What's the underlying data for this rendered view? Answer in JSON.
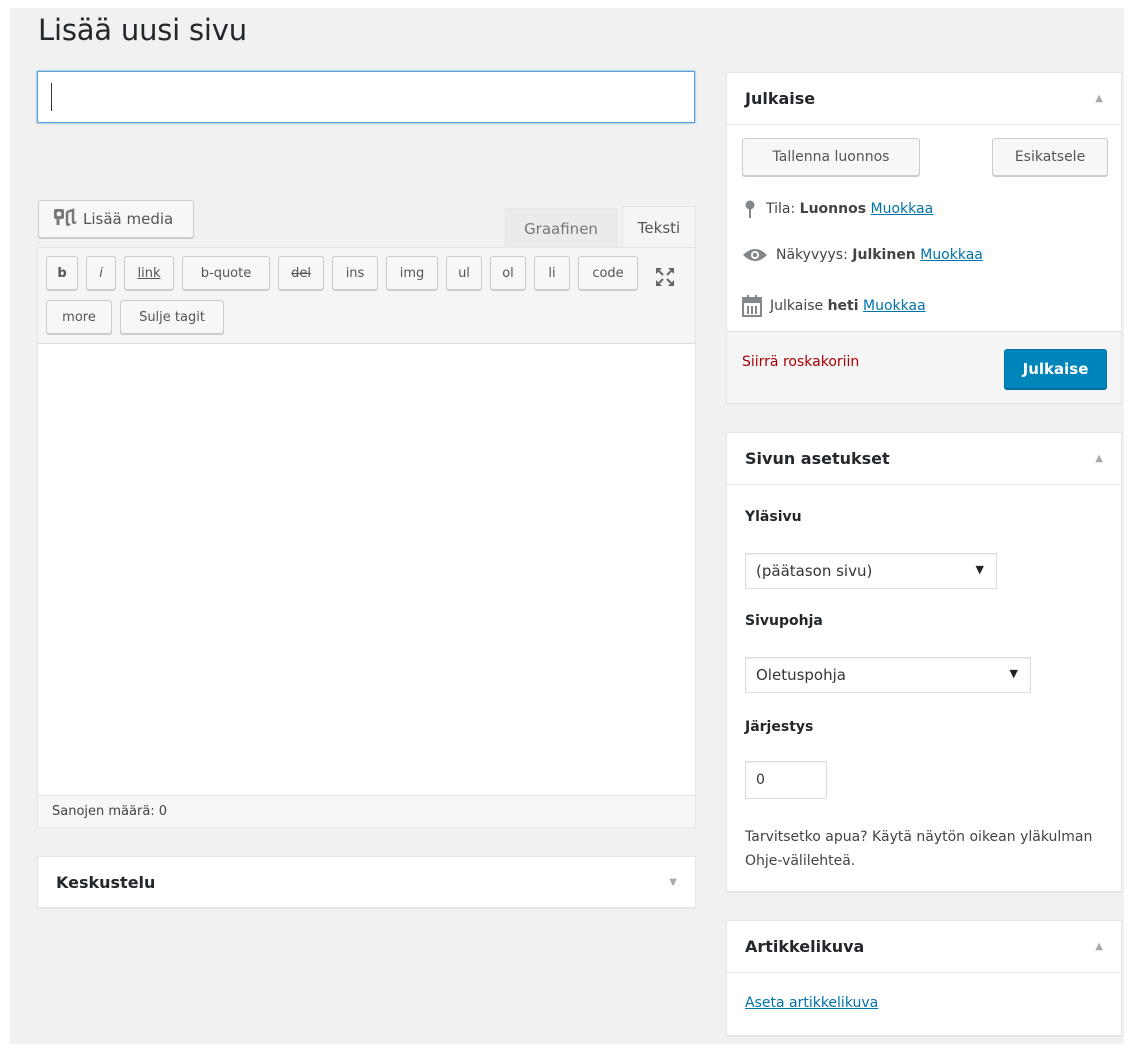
{
  "header": {
    "title": "Lisää uusi sivu"
  },
  "title_field": {
    "value": "",
    "placeholder": ""
  },
  "editor": {
    "add_media_label": "Lisää media",
    "tabs": {
      "visual": "Graafinen",
      "text": "Teksti"
    },
    "quicktags": [
      "b",
      "i",
      "link",
      "b-quote",
      "del",
      "ins",
      "img",
      "ul",
      "ol",
      "li",
      "code",
      "more",
      "Sulje tagit"
    ],
    "fullscreen_icon": "fullscreen-icon",
    "word_count": "Sanojen määrä: 0"
  },
  "discussion": {
    "title": "Keskustelu",
    "toggle": "▼"
  },
  "publish": {
    "title": "Julkaise",
    "toggle": "▲",
    "save_draft": "Tallenna luonnos",
    "preview": "Esikatsele",
    "status_label": "Tila:",
    "status_value": "Luonnos",
    "visibility_label": "Näkyvyys:",
    "visibility_value": "Julkinen",
    "schedule_label": "Julkaise",
    "schedule_value": "heti",
    "edit_link": "Muokkaa",
    "trash": "Siirrä roskakoriin",
    "publish_button": "Julkaise"
  },
  "page_attributes": {
    "title": "Sivun asetukset",
    "toggle": "▲",
    "parent_label": "Yläsivu",
    "parent_value": "(päätason sivu)",
    "template_label": "Sivupohja",
    "template_value": "Oletuspohja",
    "order_label": "Järjestys",
    "order_value": "0",
    "help": "Tarvitsetko apua? Käytä näytön oikean yläkulman Ohje-välilehteä."
  },
  "featured_image": {
    "title": "Artikkelikuva",
    "toggle": "▲",
    "set_link": "Aseta artikkelikuva"
  },
  "colors": {
    "accent": "#0085ba",
    "link": "#0073aa",
    "danger": "#a00000",
    "background": "#f1f1f1"
  }
}
